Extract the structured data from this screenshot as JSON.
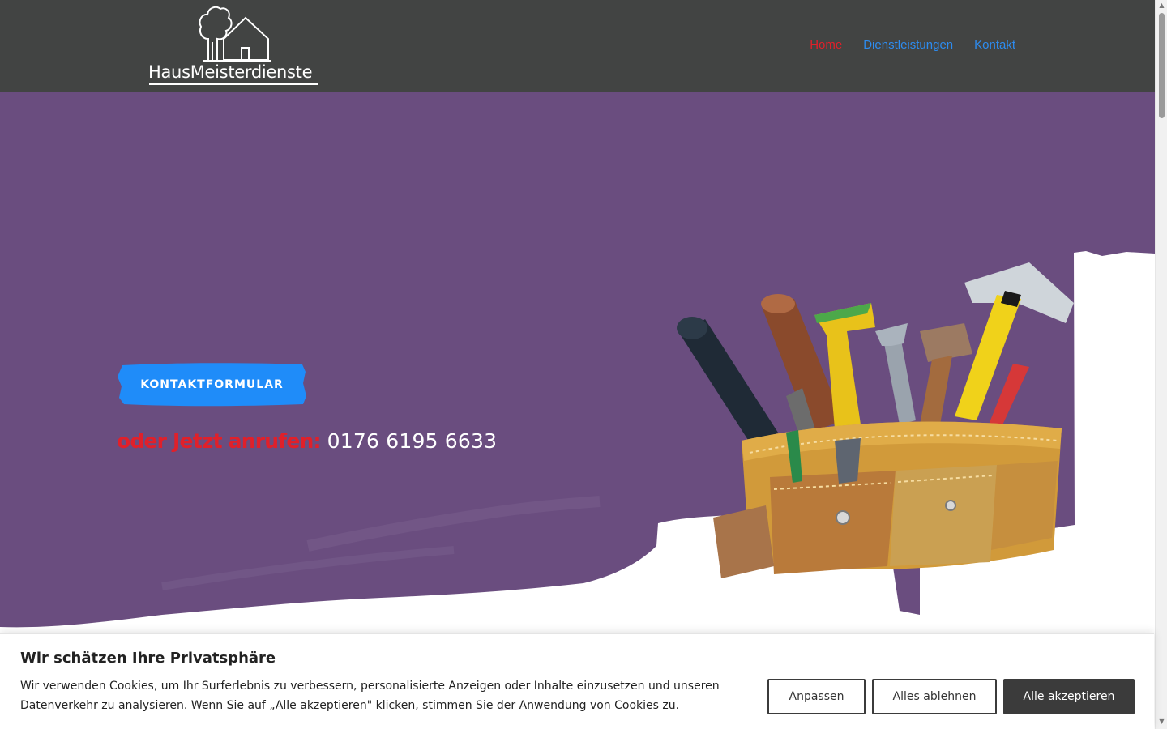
{
  "brand": {
    "logo_text": "HausMeisterdienste",
    "logo_icon": "house-tree-icon"
  },
  "nav": {
    "items": [
      {
        "label": "Home",
        "active": true
      },
      {
        "label": "Dienstleistungen",
        "active": false
      },
      {
        "label": "Kontakt",
        "active": false
      }
    ]
  },
  "hero": {
    "cta_label": "KONTAKTFORMULAR",
    "call_prefix": "oder Jetzt anrufen:",
    "phone": "0176 6195 6633",
    "image_icon": "tool-belt-image"
  },
  "cookie_banner": {
    "title": "Wir schätzen Ihre Privatsphäre",
    "text": "Wir verwenden Cookies, um Ihr Surferlebnis zu verbessern, personalisierte Anzeigen oder Inhalte einzusetzen und unseren Datenverkehr zu analysieren. Wenn Sie auf „Alle akzeptieren\" klicken, stimmen Sie der Anwendung von Cookies zu.",
    "customize_label": "Anpassen",
    "reject_label": "Alles ablehnen",
    "accept_label": "Alle akzeptieren"
  },
  "colors": {
    "header_bg": "#424443",
    "hero_bg": "#6a4d7f",
    "nav_active": "#e0202a",
    "nav_link": "#2d8cf0",
    "cta_bg": "#1f8cf9",
    "accent_red": "#e0202a",
    "button_dark": "#3b3b3b"
  }
}
